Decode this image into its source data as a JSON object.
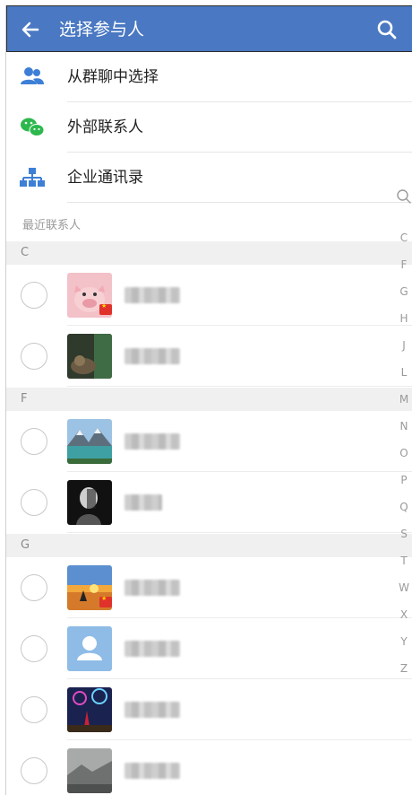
{
  "header": {
    "title": "选择参与人",
    "back_icon": "arrow-left-icon",
    "search_icon": "search-icon",
    "color": "#4A78C2"
  },
  "options": [
    {
      "label": "从群聊中选择",
      "icon": "group-chat-icon"
    },
    {
      "label": "外部联系人",
      "icon": "wechat-icon"
    },
    {
      "label": "企业通讯录",
      "icon": "org-chart-icon"
    }
  ],
  "recent": {
    "label": "最近联系人"
  },
  "sections": [
    {
      "letter": "C"
    },
    {
      "letter": "F"
    },
    {
      "letter": "G"
    }
  ],
  "index_letters": [
    "C",
    "F",
    "G",
    "H",
    "J",
    "L",
    "M",
    "N",
    "O",
    "P",
    "Q",
    "S",
    "T",
    "W",
    "X",
    "Y",
    "Z"
  ]
}
